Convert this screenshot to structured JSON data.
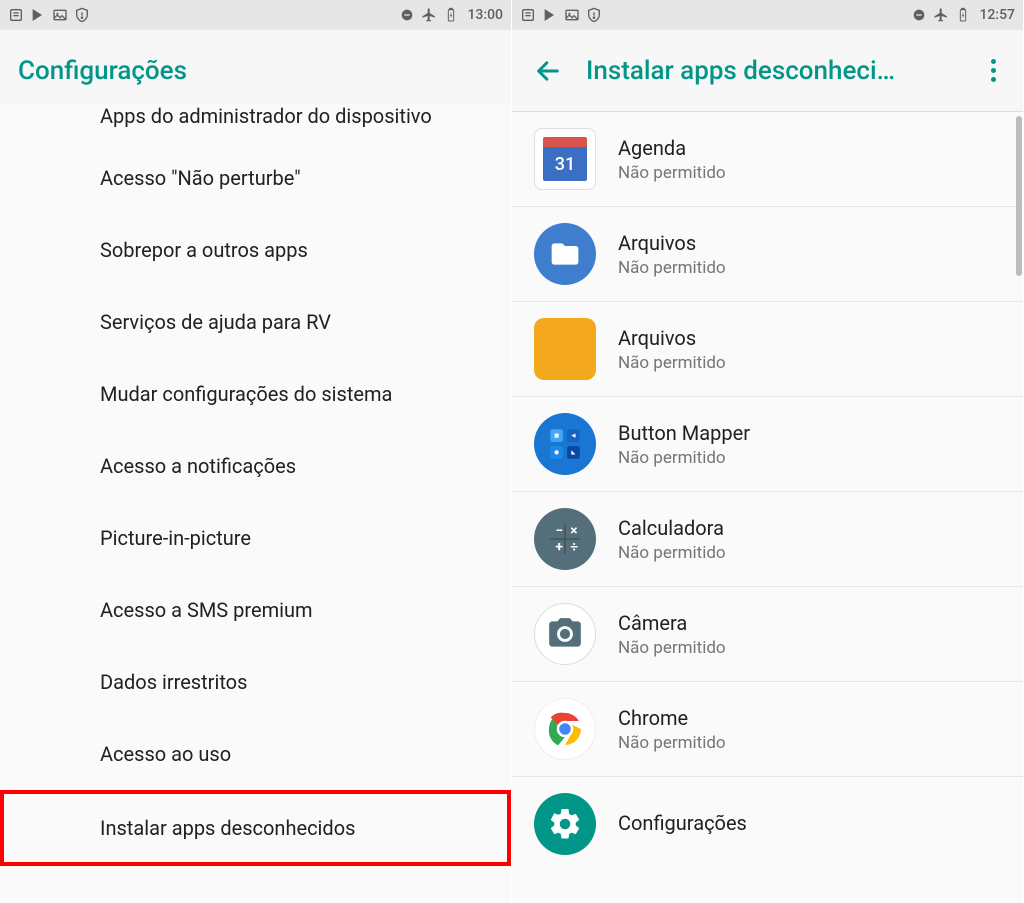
{
  "left": {
    "status": {
      "time": "13:00"
    },
    "title": "Configurações",
    "items": [
      {
        "label": "Apps do administrador do dispositivo",
        "cut": true
      },
      {
        "label": "Acesso \"Não perturbe\""
      },
      {
        "label": "Sobrepor a outros apps"
      },
      {
        "label": "Serviços de ajuda para RV"
      },
      {
        "label": "Mudar configurações do sistema"
      },
      {
        "label": "Acesso a notificações"
      },
      {
        "label": "Picture-in-picture"
      },
      {
        "label": "Acesso a SMS premium"
      },
      {
        "label": "Dados irrestritos"
      },
      {
        "label": "Acesso ao uso"
      },
      {
        "label": "Instalar apps desconhecidos",
        "highlighted": true
      }
    ]
  },
  "right": {
    "status": {
      "time": "12:57"
    },
    "title": "Instalar apps desconheci…",
    "apps": [
      {
        "name": "Agenda",
        "status": "Não permitido",
        "icon": "calendar"
      },
      {
        "name": "Arquivos",
        "status": "Não permitido",
        "icon": "files-blue"
      },
      {
        "name": "Arquivos",
        "status": "Não permitido",
        "icon": "files-orange"
      },
      {
        "name": "Button Mapper",
        "status": "Não permitido",
        "icon": "buttonmapper"
      },
      {
        "name": "Calculadora",
        "status": "Não permitido",
        "icon": "calculator"
      },
      {
        "name": "Câmera",
        "status": "Não permitido",
        "icon": "camera"
      },
      {
        "name": "Chrome",
        "status": "Não permitido",
        "icon": "chrome"
      },
      {
        "name": "Configurações",
        "status": "",
        "icon": "settings"
      }
    ]
  }
}
